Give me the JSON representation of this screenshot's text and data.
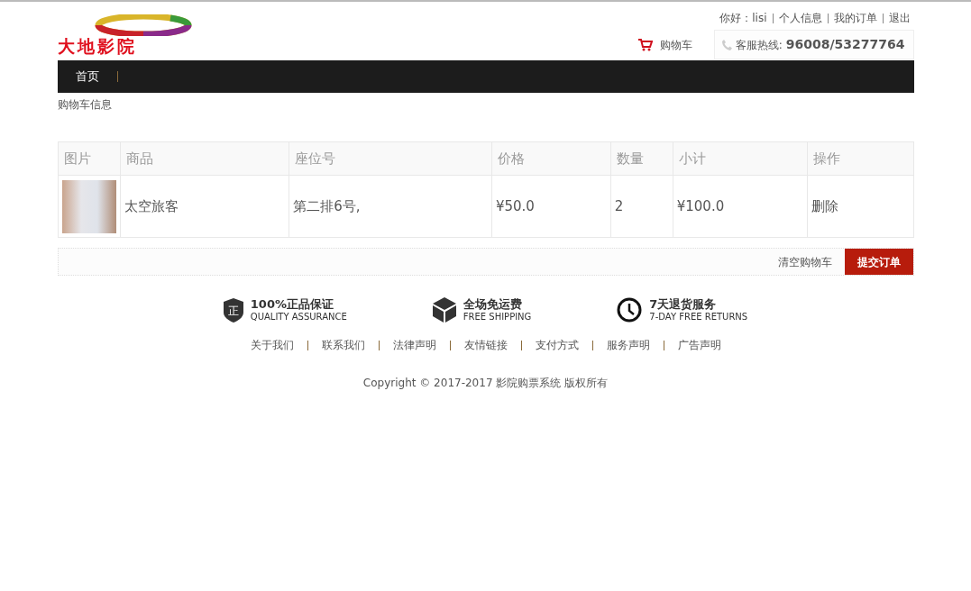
{
  "logo": {
    "text": "大地影院"
  },
  "top_links": [
    {
      "label": "你好：lisi"
    },
    {
      "label": "个人信息"
    },
    {
      "label": "我的订单"
    },
    {
      "label": "退出"
    }
  ],
  "cart_link": {
    "label": "购物车"
  },
  "hotline": {
    "label": "客服热线:",
    "number": "96008/53277764"
  },
  "nav": [
    {
      "label": "首页",
      "selected": true
    }
  ],
  "breadcrumb": "购物车信息",
  "table": {
    "columns": [
      "图片",
      "商品",
      "座位号",
      "价格",
      "数量",
      "小计",
      "操作"
    ],
    "rows": [
      {
        "product": "太空旅客",
        "seat": "第二排6号,",
        "price": "¥50.0",
        "quantity": "2",
        "subtotal": "¥100.0",
        "action": "删除"
      }
    ]
  },
  "actions": {
    "clear": "清空购物车",
    "submit": "提交订单"
  },
  "features": [
    {
      "kind": "shield",
      "icon_char": "正",
      "title": "100%正品保证",
      "subtitle": "QUALITY ASSURANCE"
    },
    {
      "kind": "box",
      "title": "全场免运费",
      "subtitle": "FREE SHIPPING"
    },
    {
      "kind": "clock",
      "title": "7天退货服务",
      "subtitle": "7-DAY FREE RETURNS"
    }
  ],
  "footer_links": [
    "关于我们",
    "联系我们",
    "法律声明",
    "友情链接",
    "支付方式",
    "服务声明",
    "广告声明"
  ],
  "copyright": "Copyright © 2017-2017 影院购票系统 版权所有"
}
